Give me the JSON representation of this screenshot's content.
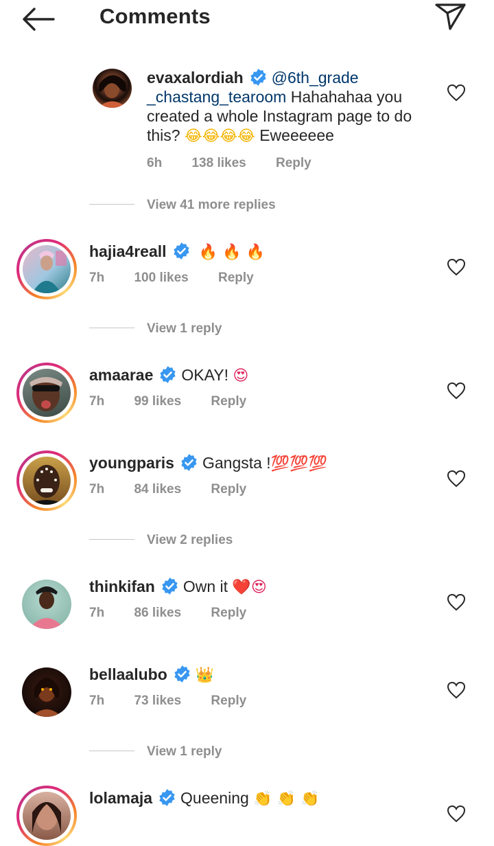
{
  "header": {
    "title": "Comments"
  },
  "comments": [
    {
      "username": "evaxalordiah",
      "mention": "@6th_grade _chastang_tearoom",
      "text": "Hahahahaa you created a whole Instagram page to do this?",
      "emoji": "😂😂😂😂",
      "after": "Eweeeeee",
      "time": "6h",
      "likes": "138 likes",
      "reply": "Reply",
      "view_replies": "View 41 more replies"
    },
    {
      "username": "hajia4reall",
      "text": "🔥 🔥 🔥",
      "time": "7h",
      "likes": "100 likes",
      "reply": "Reply",
      "view_replies": "View 1 reply"
    },
    {
      "username": "amaarae",
      "text": "OKAY!",
      "emoji": "😍",
      "time": "7h",
      "likes": "99 likes",
      "reply": "Reply"
    },
    {
      "username": "youngparis",
      "text": "Gangsta !",
      "emoji": "💯💯💯",
      "time": "7h",
      "likes": "84 likes",
      "reply": "Reply",
      "view_replies": "View 2 replies"
    },
    {
      "username": "thinkifan",
      "text": "Own it",
      "emoji": "❤️😍",
      "time": "7h",
      "likes": "86 likes",
      "reply": "Reply"
    },
    {
      "username": "bellaalubo",
      "emoji": "👑",
      "time": "7h",
      "likes": "73 likes",
      "reply": "Reply",
      "view_replies": "View 1 reply"
    },
    {
      "username": "lolamaja",
      "text": "Queening",
      "emoji": "👏 👏 👏"
    }
  ],
  "colors": {
    "verified": "#3897f0",
    "meta": "#8e8e8e",
    "mention": "#00376b"
  }
}
